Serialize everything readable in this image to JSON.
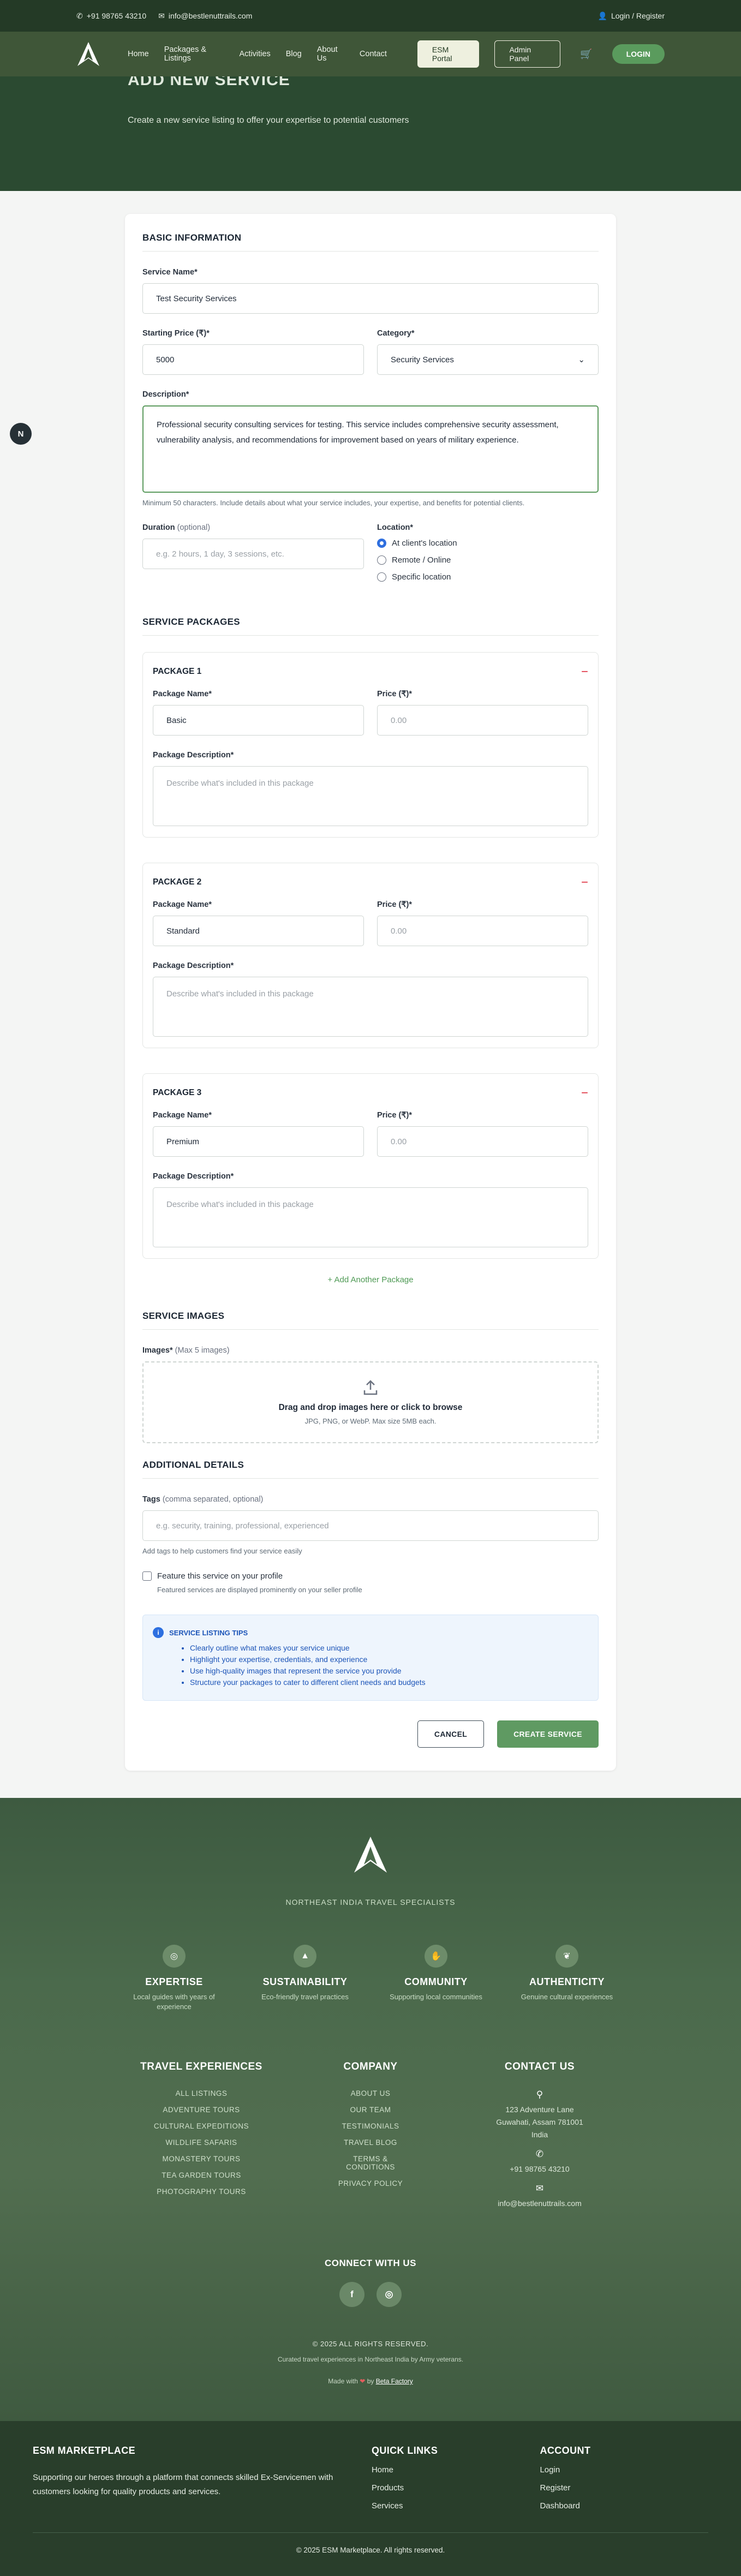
{
  "topbar": {
    "phone": "+91 98765 43210",
    "email": "info@bestlenuttrails.com",
    "auth": "Login / Register"
  },
  "nav": {
    "items": [
      "Home",
      "Packages & Listings",
      "Activities",
      "Blog",
      "About Us",
      "Contact"
    ],
    "esm_portal": "ESM Portal",
    "admin_panel": "Admin Panel",
    "login": "LOGIN"
  },
  "hero": {
    "title": "ADD NEW SERVICE",
    "subtitle": "Create a new service listing to offer your expertise to potential customers"
  },
  "basic": {
    "heading": "BASIC INFORMATION",
    "service_name_label": "Service Name*",
    "service_name": "Test Security Services",
    "price_label": "Starting Price (₹)*",
    "price": "5000",
    "category_label": "Category*",
    "category": "Security Services",
    "description_label": "Description*",
    "description": "Professional security consulting services for testing. This service includes comprehensive security assessment, vulnerability analysis, and recommendations for improvement based on years of military experience.",
    "description_hint": "Minimum 50 characters. Include details about what your service includes, your expertise, and benefits for potential clients.",
    "duration_label": "Duration",
    "duration_optional": "(optional)",
    "duration_placeholder": "e.g. 2 hours, 1 day, 3 sessions, etc.",
    "location_label": "Location*",
    "locations": [
      "At client's location",
      "Remote / Online",
      "Specific location"
    ]
  },
  "packages": {
    "heading": "SERVICE PACKAGES",
    "name_label": "Package Name*",
    "price_label": "Price (₹)*",
    "price_placeholder": "0.00",
    "desc_label": "Package Description*",
    "desc_placeholder": "Describe what's included in this package",
    "remove": "−",
    "items": [
      {
        "title": "PACKAGE 1",
        "name": "Basic"
      },
      {
        "title": "PACKAGE 2",
        "name": "Standard"
      },
      {
        "title": "PACKAGE 3",
        "name": "Premium"
      }
    ],
    "add": "+ Add Another Package"
  },
  "images": {
    "heading": "SERVICE IMAGES",
    "label": "Images*",
    "max": "(Max 5 images)",
    "drop": "Drag and drop images here or click to browse",
    "formats": "JPG, PNG, or WebP. Max size 5MB each."
  },
  "additional": {
    "heading": "ADDITIONAL DETAILS",
    "tags_label": "Tags",
    "tags_optional": "(comma separated, optional)",
    "tags_placeholder": "e.g. security, training, professional, experienced",
    "tags_hint": "Add tags to help customers find your service easily",
    "feature_label": "Feature this service on your profile",
    "feature_hint": "Featured services are displayed prominently on your seller profile"
  },
  "tips": {
    "heading": "SERVICE LISTING TIPS",
    "items": [
      "Clearly outline what makes your service unique",
      "Highlight your expertise, credentials, and experience",
      "Use high-quality images that represent the service you provide",
      "Structure your packages to cater to different client needs and budgets"
    ]
  },
  "actions": {
    "cancel": "CANCEL",
    "create": "CREATE SERVICE"
  },
  "footer": {
    "tagline": "NORTHEAST INDIA TRAVEL SPECIALISTS",
    "features": [
      {
        "t": "EXPERTISE",
        "d": "Local guides with years of experience"
      },
      {
        "t": "SUSTAINABILITY",
        "d": "Eco-friendly travel practices"
      },
      {
        "t": "COMMUNITY",
        "d": "Supporting local communities"
      },
      {
        "t": "AUTHENTICITY",
        "d": "Genuine cultural experiences"
      }
    ],
    "travel_heading": "TRAVEL EXPERIENCES",
    "travel": [
      "ALL LISTINGS",
      "ADVENTURE TOURS",
      "CULTURAL EXPEDITIONS",
      "WILDLIFE SAFARIS",
      "MONASTERY TOURS",
      "TEA GARDEN TOURS",
      "PHOTOGRAPHY TOURS"
    ],
    "company_heading": "COMPANY",
    "company": [
      "ABOUT US",
      "OUR TEAM",
      "TESTIMONIALS",
      "TRAVEL BLOG",
      "TERMS & CONDITIONS",
      "PRIVACY POLICY"
    ],
    "contact_heading": "CONTACT US",
    "address": "123 Adventure Lane\nGuwahati, Assam 781001\nIndia",
    "phone": "+91 98765 43210",
    "email": "info@bestlenuttrails.com",
    "connect": "CONNECT WITH US",
    "copyright": "© 2025 ALL RIGHTS RESERVED.",
    "sub": "Curated travel experiences in Northeast India by Army veterans.",
    "made_pre": "Made with",
    "made_by": "by",
    "made_name": "Beta Factory"
  },
  "esm": {
    "heading": "ESM MARKETPLACE",
    "text": "Supporting our heroes through a platform that connects skilled Ex-Servicemen with customers looking for quality products and services.",
    "quick_heading": "QUICK LINKS",
    "quick": [
      "Home",
      "Products",
      "Services"
    ],
    "account_heading": "ACCOUNT",
    "account": [
      "Login",
      "Register",
      "Dashboard"
    ],
    "copyright": "© 2025 ESM Marketplace. All rights reserved."
  }
}
